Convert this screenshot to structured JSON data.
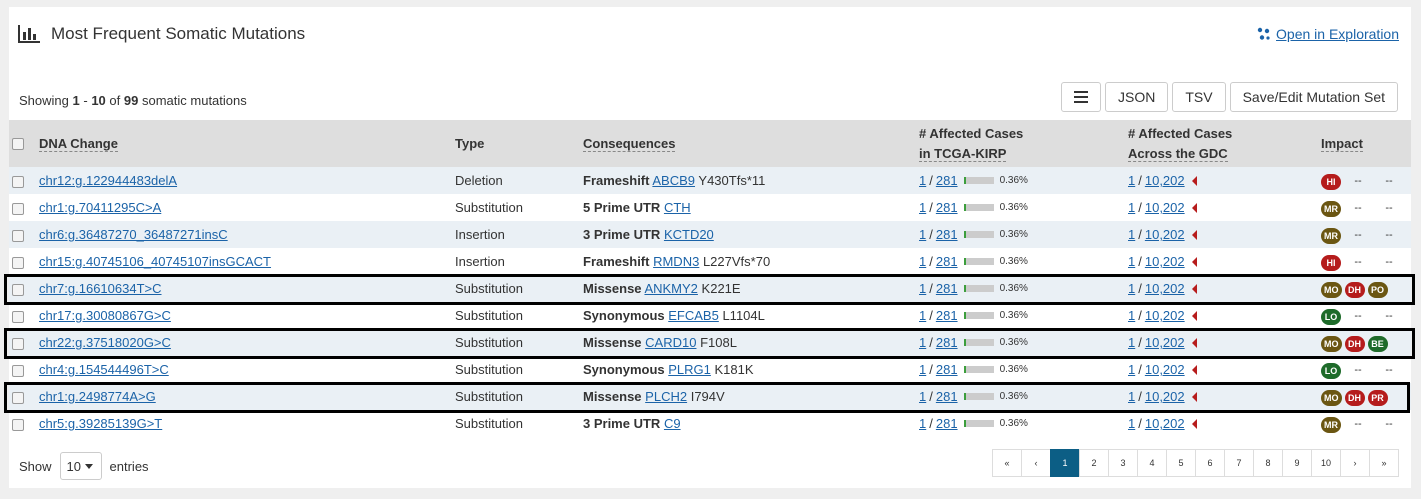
{
  "header": {
    "title": "Most Frequent Somatic Mutations",
    "explore_label": "Open in Exploration"
  },
  "summary": {
    "prefix": "Showing",
    "start": "1",
    "sep": "-",
    "end": "10",
    "of": "of",
    "total": "99",
    "suffix": "somatic mutations"
  },
  "toolbar": {
    "json": "JSON",
    "tsv": "TSV",
    "save": "Save/Edit Mutation Set"
  },
  "columns": {
    "dna_change": "DNA Change",
    "type": "Type",
    "consequences": "Consequences",
    "affected_tcga_1": "# Affected Cases",
    "affected_tcga_2": "in TCGA-KIRP",
    "affected_gdc_1": "# Affected Cases",
    "affected_gdc_2": "Across the GDC",
    "impact": "Impact"
  },
  "impact_colors": {
    "HI": "#b51c1c",
    "MR": "#6b5612",
    "MO": "#6b5612",
    "DH": "#b51c1c",
    "PO": "#6b5612",
    "LO": "#1e6b2a",
    "BE": "#1e6b2a",
    "PR": "#b51c1c"
  },
  "rows": [
    {
      "dna": "chr12:g.122944483delA",
      "type": "Deletion",
      "cons": "Frameshift",
      "gene": "ABCB9",
      "aa": "Y430Tfs*11",
      "n": "1",
      "total": "281",
      "pct": "0.36%",
      "gn": "1",
      "gtotal": "10,202",
      "impact": [
        "HI"
      ],
      "d1": "--",
      "d2": "--"
    },
    {
      "dna": "chr1:g.70411295C>A",
      "type": "Substitution",
      "cons": "5 Prime UTR",
      "gene": "CTH",
      "aa": "",
      "n": "1",
      "total": "281",
      "pct": "0.36%",
      "gn": "1",
      "gtotal": "10,202",
      "impact": [
        "MR"
      ],
      "d1": "--",
      "d2": "--"
    },
    {
      "dna": "chr6:g.36487270_36487271insC",
      "type": "Insertion",
      "cons": "3 Prime UTR",
      "gene": "KCTD20",
      "aa": "",
      "n": "1",
      "total": "281",
      "pct": "0.36%",
      "gn": "1",
      "gtotal": "10,202",
      "impact": [
        "MR"
      ],
      "d1": "--",
      "d2": "--"
    },
    {
      "dna": "chr15:g.40745106_40745107insGCACT",
      "type": "Insertion",
      "cons": "Frameshift",
      "gene": "RMDN3",
      "aa": "L227Vfs*70",
      "n": "1",
      "total": "281",
      "pct": "0.36%",
      "gn": "1",
      "gtotal": "10,202",
      "impact": [
        "HI"
      ],
      "d1": "--",
      "d2": "--"
    },
    {
      "dna": "chr7:g.16610634T>C",
      "type": "Substitution",
      "cons": "Missense",
      "gene": "ANKMY2",
      "aa": "K221E",
      "n": "1",
      "total": "281",
      "pct": "0.36%",
      "gn": "1",
      "gtotal": "10,202",
      "impact": [
        "MO",
        "DH",
        "PO"
      ],
      "d1": "",
      "d2": ""
    },
    {
      "dna": "chr17:g.30080867G>C",
      "type": "Substitution",
      "cons": "Synonymous",
      "gene": "EFCAB5",
      "aa": "L1104L",
      "n": "1",
      "total": "281",
      "pct": "0.36%",
      "gn": "1",
      "gtotal": "10,202",
      "impact": [
        "LO"
      ],
      "d1": "--",
      "d2": "--"
    },
    {
      "dna": "chr22:g.37518020G>C",
      "type": "Substitution",
      "cons": "Missense",
      "gene": "CARD10",
      "aa": "F108L",
      "n": "1",
      "total": "281",
      "pct": "0.36%",
      "gn": "1",
      "gtotal": "10,202",
      "impact": [
        "MO",
        "DH",
        "BE"
      ],
      "d1": "",
      "d2": ""
    },
    {
      "dna": "chr4:g.154544496T>C",
      "type": "Substitution",
      "cons": "Synonymous",
      "gene": "PLRG1",
      "aa": "K181K",
      "n": "1",
      "total": "281",
      "pct": "0.36%",
      "gn": "1",
      "gtotal": "10,202",
      "impact": [
        "LO"
      ],
      "d1": "--",
      "d2": "--"
    },
    {
      "dna": "chr1:g.2498774A>G",
      "type": "Substitution",
      "cons": "Missense",
      "gene": "PLCH2",
      "aa": "I794V",
      "n": "1",
      "total": "281",
      "pct": "0.36%",
      "gn": "1",
      "gtotal": "10,202",
      "impact": [
        "MO",
        "DH",
        "PR"
      ],
      "d1": "",
      "d2": ""
    },
    {
      "dna": "chr5:g.39285139G>T",
      "type": "Substitution",
      "cons": "3 Prime UTR",
      "gene": "C9",
      "aa": "",
      "n": "1",
      "total": "281",
      "pct": "0.36%",
      "gn": "1",
      "gtotal": "10,202",
      "impact": [
        "MR"
      ],
      "d1": "--",
      "d2": "--"
    }
  ],
  "footer": {
    "show_label": "Show",
    "page_size": "10",
    "entries_label": "entries",
    "pages": [
      "«",
      "‹",
      "1",
      "2",
      "3",
      "4",
      "5",
      "6",
      "7",
      "8",
      "9",
      "10",
      "›",
      "»"
    ],
    "active_page": "1"
  }
}
